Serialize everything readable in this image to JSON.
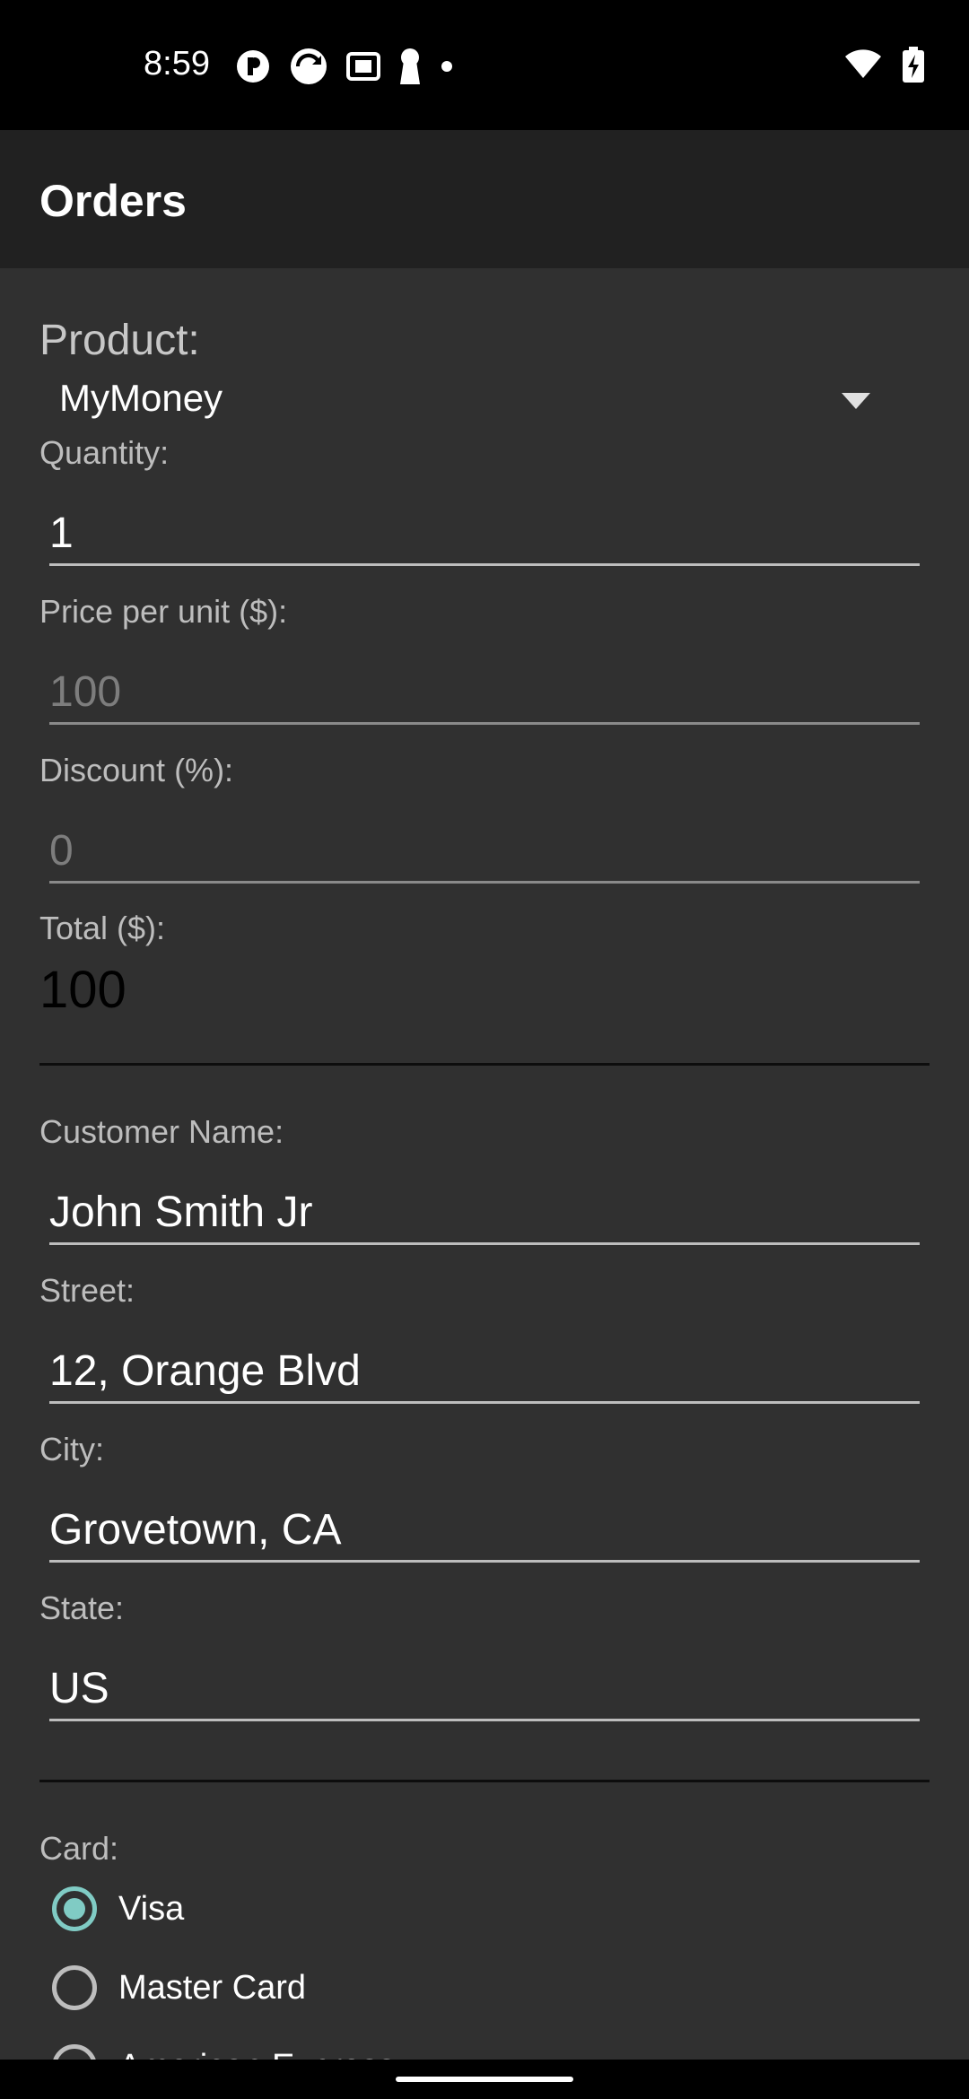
{
  "status": {
    "time": "8:59"
  },
  "appbar": {
    "title": "Orders"
  },
  "product": {
    "label": "Product:",
    "selected": "MyMoney"
  },
  "quantity": {
    "label": "Quantity:",
    "value": "1"
  },
  "price": {
    "label": "Price per unit ($):",
    "value": "100"
  },
  "discount": {
    "label": "Discount (%):",
    "value": "0"
  },
  "total": {
    "label": "Total ($):",
    "value": "100"
  },
  "customer": {
    "name_label": "Customer Name:",
    "name_value": "John Smith Jr",
    "street_label": "Street:",
    "street_value": "12, Orange Blvd",
    "city_label": "City:",
    "city_value": "Grovetown, CA",
    "state_label": "State:",
    "state_value": "US"
  },
  "card": {
    "label": "Card:",
    "options": [
      {
        "label": "Visa",
        "checked": true
      },
      {
        "label": "Master Card",
        "checked": false
      },
      {
        "label": "American Express",
        "checked": false
      }
    ]
  },
  "colors": {
    "accent": "#80cbc4",
    "background": "#303030",
    "appbar": "#212121"
  }
}
